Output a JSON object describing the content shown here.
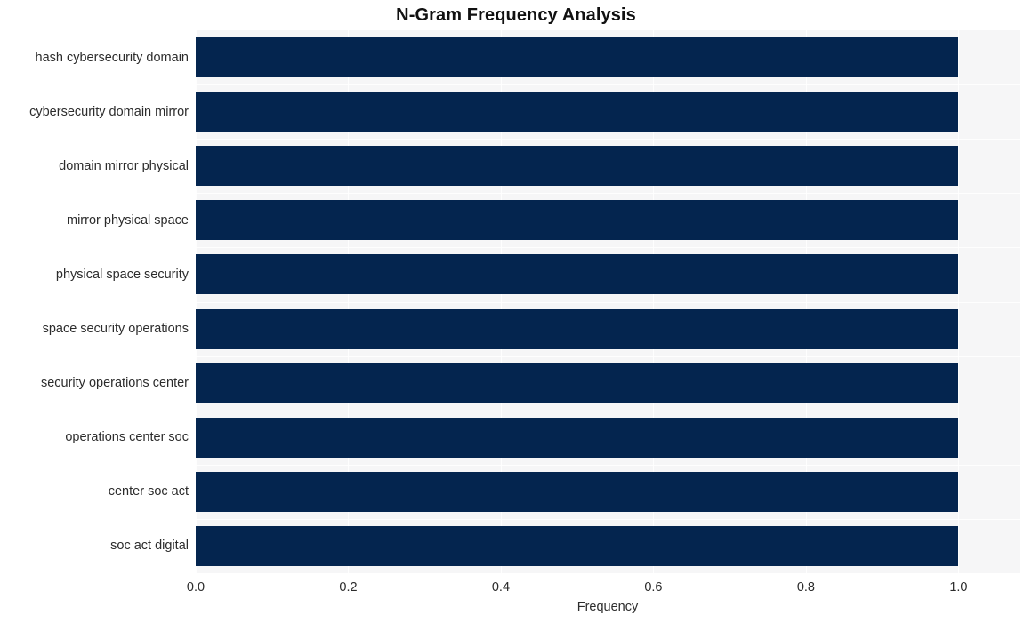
{
  "chart_data": {
    "type": "bar",
    "orientation": "horizontal",
    "title": "N-Gram Frequency Analysis",
    "xlabel": "Frequency",
    "ylabel": "",
    "categories": [
      "hash cybersecurity domain",
      "cybersecurity domain mirror",
      "domain mirror physical",
      "mirror physical space",
      "physical space security",
      "space security operations",
      "security operations center",
      "operations center soc",
      "center soc act",
      "soc act digital"
    ],
    "values": [
      1.0,
      1.0,
      1.0,
      1.0,
      1.0,
      1.0,
      1.0,
      1.0,
      1.0,
      1.0
    ],
    "xlim": [
      0.0,
      1.08
    ],
    "xticks": [
      0.0,
      0.2,
      0.4,
      0.6,
      0.8,
      1.0
    ],
    "xticklabels": [
      "0.0",
      "0.2",
      "0.4",
      "0.6",
      "0.8",
      "1.0"
    ],
    "grid": true,
    "grid_color": "#ffffff",
    "legend": null,
    "bar_color": "#04254f",
    "plot_background": "#f6f6f7",
    "figure_background": "#ffffff"
  }
}
